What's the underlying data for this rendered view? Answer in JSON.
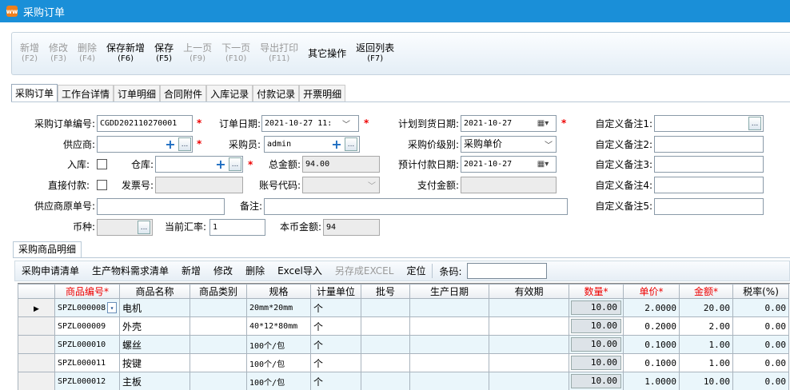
{
  "window": {
    "title": "采购订单",
    "icon_text": "ww"
  },
  "toolbar": [
    {
      "label": "新增",
      "key": "(F2)",
      "enabled": false
    },
    {
      "label": "修改",
      "key": "(F3)",
      "enabled": false
    },
    {
      "label": "删除",
      "key": "(F4)",
      "enabled": false
    },
    {
      "label": "保存新增",
      "key": "(F6)",
      "enabled": true
    },
    {
      "label": "保存",
      "key": "(F5)",
      "enabled": true
    },
    {
      "label": "上一页",
      "key": "(F9)",
      "enabled": false
    },
    {
      "label": "下一页",
      "key": "(F10)",
      "enabled": false
    },
    {
      "label": "导出打印",
      "key": "(F11)",
      "enabled": false
    },
    {
      "label": "其它操作",
      "key": "",
      "enabled": true
    },
    {
      "label": "返回列表",
      "key": "(F7)",
      "enabled": true
    }
  ],
  "tabs": [
    "采购订单",
    "工作台详情",
    "订单明细",
    "合同附件",
    "入库记录",
    "付款记录",
    "开票明细"
  ],
  "form": {
    "order_no_label": "采购订单编号:",
    "order_no": "CGDD202110270001",
    "order_date_label": "订单日期:",
    "order_date": "2021-10-27 11:",
    "plan_date_label": "计划到货日期:",
    "plan_date": "2021-10-27",
    "custom1_label": "自定义备注1:",
    "supplier_label": "供应商:",
    "buyer_label": "采购员:",
    "buyer": "admin",
    "price_level_label": "采购价级别:",
    "price_level": "采购单价",
    "custom2_label": "自定义备注2:",
    "stock_in_label": "入库:",
    "warehouse_label": "仓库:",
    "total_label": "总金额:",
    "total": "94.00",
    "pay_date_label": "预计付款日期:",
    "pay_date": "2021-10-27",
    "custom3_label": "自定义备注3:",
    "direct_pay_label": "直接付款:",
    "invoice_label": "发票号:",
    "account_label": "账号代码:",
    "paid_label": "支付金额:",
    "custom4_label": "自定义备注4:",
    "supplier_orig_label": "供应商原单号:",
    "remark_label": "备注:",
    "custom5_label": "自定义备注5:",
    "currency_label": "币种:",
    "rate_label": "当前汇率:",
    "rate": "1",
    "local_amount_label": "本币金额:",
    "local_amount": "94",
    "more_dots": "..."
  },
  "detail": {
    "section_title": "采购商品明细",
    "buttons": [
      {
        "label": "采购申请清单",
        "enabled": true
      },
      {
        "label": "生产物料需求清单",
        "enabled": true
      },
      {
        "label": "新增",
        "enabled": true
      },
      {
        "label": "修改",
        "enabled": true
      },
      {
        "label": "删除",
        "enabled": true
      },
      {
        "label": "Excel导入",
        "enabled": true
      },
      {
        "label": "另存成EXCEL",
        "enabled": false
      },
      {
        "label": "定位",
        "enabled": true
      }
    ],
    "barcode_label": "条码:",
    "columns": [
      "商品编号*",
      "商品名称",
      "商品类别",
      "规格",
      "计量单位",
      "批号",
      "生产日期",
      "有效期",
      "数量*",
      "单价*",
      "金额*",
      "税率(%)"
    ],
    "rows": [
      {
        "code": "SPZL000008",
        "name": "电机",
        "category": "",
        "spec": "20mm*20mm",
        "unit": "个",
        "batch": "",
        "mfg": "",
        "expiry": "",
        "qty": "10.00",
        "price": "2.0000",
        "amount": "20.00",
        "tax": "0.00"
      },
      {
        "code": "SPZL000009",
        "name": "外壳",
        "category": "",
        "spec": "40*12*80mm",
        "unit": "个",
        "batch": "",
        "mfg": "",
        "expiry": "",
        "qty": "10.00",
        "price": "0.2000",
        "amount": "2.00",
        "tax": "0.00"
      },
      {
        "code": "SPZL000010",
        "name": "螺丝",
        "category": "",
        "spec": "100个/包",
        "unit": "个",
        "batch": "",
        "mfg": "",
        "expiry": "",
        "qty": "10.00",
        "price": "0.1000",
        "amount": "1.00",
        "tax": "0.00"
      },
      {
        "code": "SPZL000011",
        "name": "按键",
        "category": "",
        "spec": "100个/包",
        "unit": "个",
        "batch": "",
        "mfg": "",
        "expiry": "",
        "qty": "10.00",
        "price": "0.1000",
        "amount": "1.00",
        "tax": "0.00"
      },
      {
        "code": "SPZL000012",
        "name": "主板",
        "category": "",
        "spec": "100个/包",
        "unit": "个",
        "batch": "",
        "mfg": "",
        "expiry": "",
        "qty": "10.00",
        "price": "1.0000",
        "amount": "10.00",
        "tax": "0.00"
      }
    ]
  },
  "colors": {
    "titlebar": "#1a8fd8",
    "required": "#ee0000",
    "row_alt": "#eaf6fb"
  }
}
